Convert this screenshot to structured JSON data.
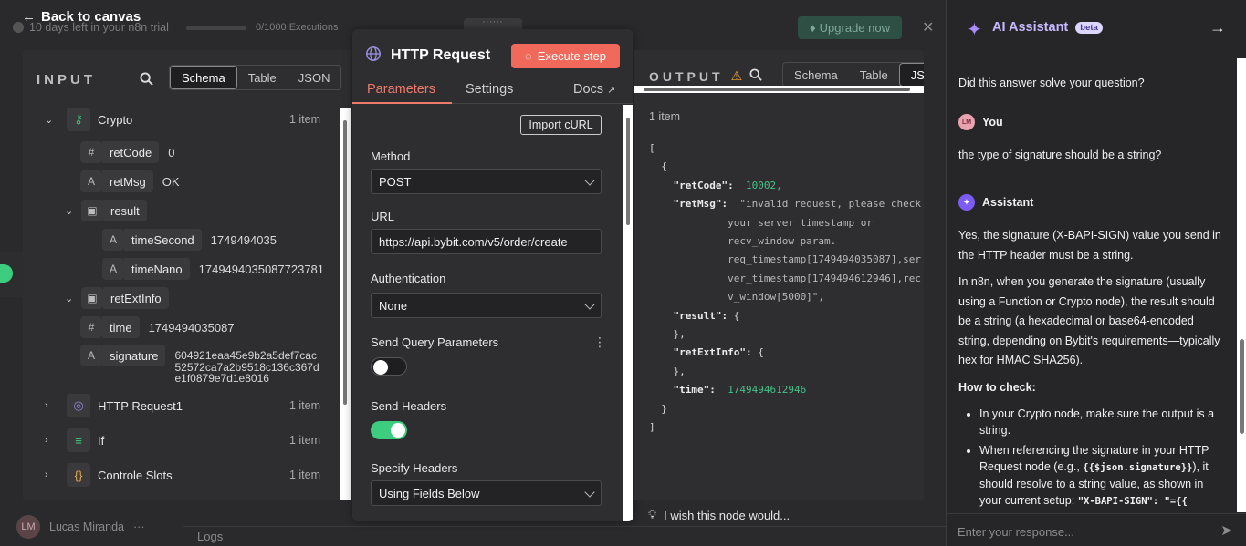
{
  "topbar": {
    "back_label": "Back to canvas",
    "trial_text": "10 days left in your n8n trial",
    "executions": "0/1000 Executions",
    "upgrade_label": "Upgrade now",
    "drag_handle": "::::::"
  },
  "input": {
    "title": "INPUT",
    "tabs": [
      "Schema",
      "Table",
      "JSON"
    ],
    "active_tab": "Schema",
    "nodes": [
      {
        "name": "Crypto",
        "count": "1 item"
      },
      {
        "name": "HTTP Request1",
        "count": "1 item"
      },
      {
        "name": "If",
        "count": "1 item"
      },
      {
        "name": "Controle Slots",
        "count": "1 item"
      }
    ],
    "fields": {
      "retCode": {
        "key": "retCode",
        "type": "#",
        "value": "0"
      },
      "retMsg": {
        "key": "retMsg",
        "type": "A",
        "value": "OK"
      },
      "result": {
        "key": "result"
      },
      "timeSecond": {
        "key": "timeSecond",
        "type": "A",
        "value": "1749494035"
      },
      "timeNano": {
        "key": "timeNano",
        "type": "A",
        "value": "1749494035087723781"
      },
      "retExtInfo": {
        "key": "retExtInfo"
      },
      "time": {
        "key": "time",
        "type": "#",
        "value": "1749494035087"
      },
      "signature": {
        "key": "signature",
        "type": "A",
        "value_lines": [
          "604921eaa45e9b2a5def7cac",
          "52572ca7a2b9518c136c367d",
          "e1f0879e7d1e8016"
        ]
      }
    }
  },
  "http": {
    "title": "HTTP Request",
    "execute_label": "Execute step",
    "tabs": {
      "parameters": "Parameters",
      "settings": "Settings",
      "docs": "Docs"
    },
    "import_curl": "Import cURL",
    "method_label": "Method",
    "method_value": "POST",
    "url_label": "URL",
    "url_value": "https://api.bybit.com/v5/order/create",
    "auth_label": "Authentication",
    "auth_value": "None",
    "send_query_label": "Send Query Parameters",
    "send_query_on": false,
    "send_headers_label": "Send Headers",
    "send_headers_on": true,
    "specify_headers_label": "Specify Headers",
    "specify_headers_value": "Using Fields Below"
  },
  "output": {
    "title": "OUTPUT",
    "tabs": [
      "Schema",
      "Table",
      "JSON"
    ],
    "active_tab": "JSON",
    "items_label": "1 item",
    "json_lines": {
      "retCode_key": "\"retCode\":",
      "retCode_val": "10002,",
      "retMsg_key": "\"retMsg\":",
      "retMsg_l1": "\"invalid request, please check",
      "retMsg_l2": "your server timestamp or",
      "retMsg_l3": "recv_window param.",
      "retMsg_l4": "req_timestamp[1749494035087],ser",
      "retMsg_l5": "ver_timestamp[1749494612946],rec",
      "retMsg_l6": "v_window[5000]\",",
      "result_key": "\"result\":",
      "retExtInfo_key": "\"retExtInfo\":",
      "time_key": "\"time\":",
      "time_val": "1749494612946"
    }
  },
  "bottom": {
    "user_initials": "LM",
    "user_name": "Lucas Miranda",
    "logs_label": "Logs",
    "wish_text": "I wish this node would..."
  },
  "assistant": {
    "title": "AI Assistant",
    "badge": "beta",
    "question": "Did this answer solve your question?",
    "user_author": "You",
    "user_initials": "LM",
    "user_message": "the type of signature should be a string?",
    "assistant_author": "Assistant",
    "answer_p1": "Yes, the signature (X-BAPI-SIGN) value you send in the HTTP header must be a string.",
    "answer_p2": "In n8n, when you generate the signature (usually using a Function or Crypto node), the result should be a string (a hexadecimal or base64-encoded string, depending on Bybit's requirements—typically hex for HMAC SHA256).",
    "how_to_check": "How to check:",
    "bullet1": "In your Crypto node, make sure the output is a string.",
    "bullet2_a": "When referencing the signature in your HTTP Request node (e.g.,",
    "bullet2_code": "{{$json.signature}}",
    "bullet2_b": "), it should resolve to a string value, as shown in your current setup:",
    "bullet2_code2": "\"X-BAPI-SIGN\": \"={{ $json.signature }}\"",
    "input_placeholder": "Enter your response..."
  }
}
